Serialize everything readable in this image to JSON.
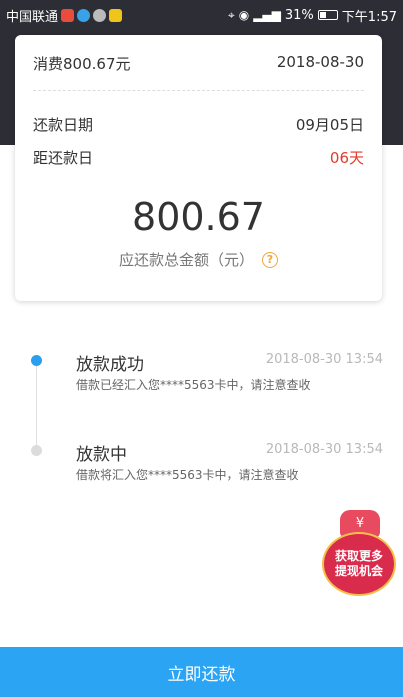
{
  "status_bar": {
    "carrier": "中国联通",
    "battery": "31%",
    "time": "下午1:57"
  },
  "card": {
    "consume_label": "消费800.67元",
    "consume_date": "2018-08-30",
    "repay_date_label": "还款日期",
    "repay_date_value": "09月05日",
    "days_left_label": "距还款日",
    "days_left_value": "06天",
    "amount": "800.67",
    "amount_label": "应还款总金额（元）",
    "help_icon": "?"
  },
  "timeline": [
    {
      "title": "放款成功",
      "time": "2018-08-30 13:54",
      "desc": "借款已经汇入您****5563卡中，请注意查收",
      "status": "done"
    },
    {
      "title": "放款中",
      "time": "2018-08-30 13:54",
      "desc": "借款将汇入您****5563卡中，请注意查收",
      "status": "pending"
    }
  ],
  "promo": {
    "bag_symbol": "¥",
    "line1": "获取更多",
    "line2": "提现机会"
  },
  "bottom_button": "立即还款",
  "colors": {
    "header_bg": "#2d2e35",
    "accent": "#2ba4f4",
    "warn": "#e23a2e"
  }
}
